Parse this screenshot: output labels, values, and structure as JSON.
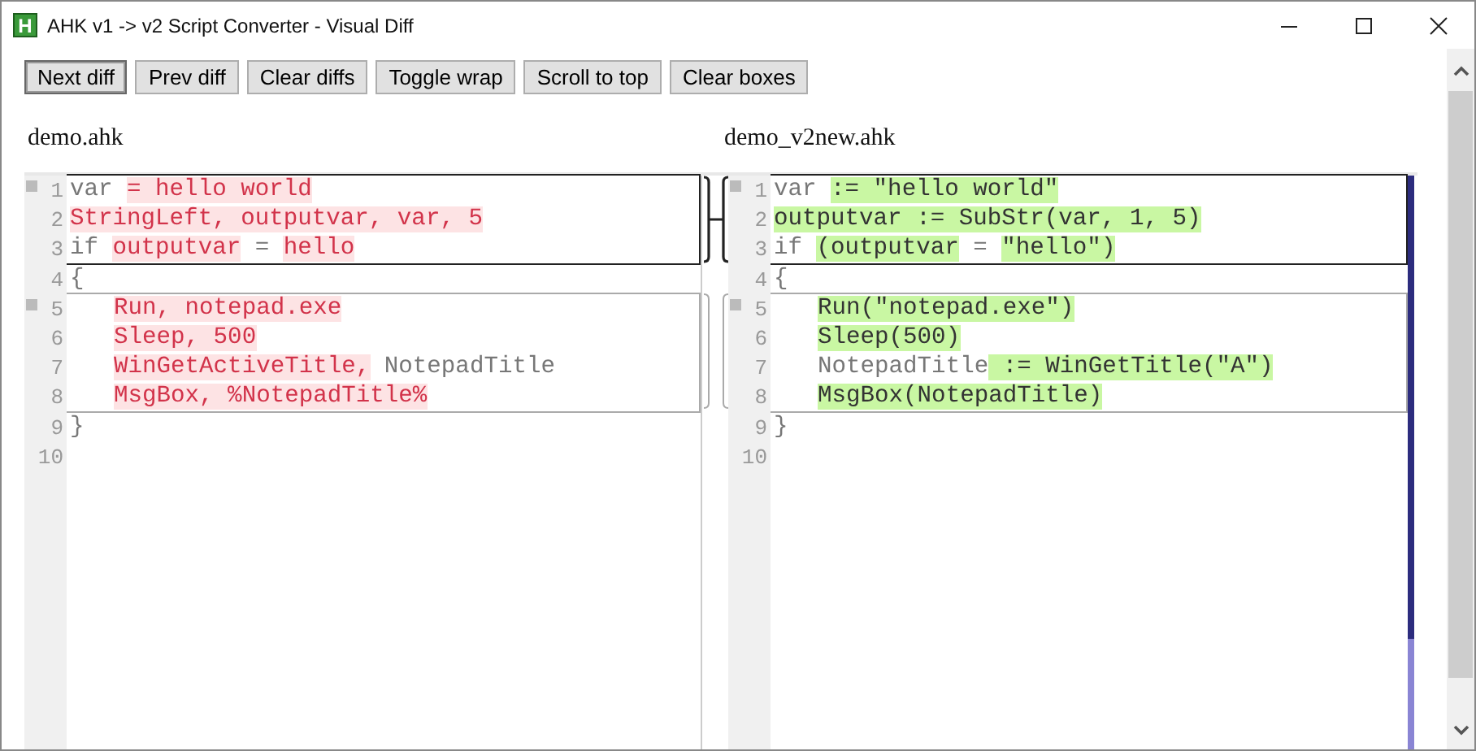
{
  "window": {
    "icon_letter": "H",
    "title": "AHK v1 -> v2 Script Converter - Visual Diff"
  },
  "toolbar": [
    {
      "label": "Next diff",
      "focused": true
    },
    {
      "label": "Prev diff",
      "focused": false
    },
    {
      "label": "Clear diffs",
      "focused": false
    },
    {
      "label": "Toggle wrap",
      "focused": false
    },
    {
      "label": "Scroll to top",
      "focused": false
    },
    {
      "label": "Clear boxes",
      "focused": false
    }
  ],
  "panes": [
    {
      "filename": "demo.ahk",
      "kind": "removed",
      "groups": [
        {
          "kind": "hunk",
          "active": true,
          "lines": [
            {
              "number": "1",
              "indented": false,
              "segments": [
                {
                  "text": "var ",
                  "changed": false
                },
                {
                  "text": "= hello world",
                  "changed": true
                }
              ]
            },
            {
              "number": "2",
              "indented": false,
              "segments": [
                {
                  "text": "StringLeft, outputvar, var, 5",
                  "changed": true
                }
              ]
            },
            {
              "number": "3",
              "indented": false,
              "segments": [
                {
                  "text": "if ",
                  "changed": false
                },
                {
                  "text": "outputvar",
                  "changed": true
                },
                {
                  "text": " = ",
                  "changed": false
                },
                {
                  "text": "hello",
                  "changed": true
                }
              ]
            }
          ]
        },
        {
          "kind": "plain",
          "lines": [
            {
              "number": "4",
              "indented": false,
              "segments": [
                {
                  "text": "{",
                  "changed": false
                }
              ]
            }
          ]
        },
        {
          "kind": "hunk",
          "active": false,
          "lines": [
            {
              "number": "5",
              "indented": true,
              "segments": [
                {
                  "text": "Run, notepad.exe",
                  "changed": true
                }
              ]
            },
            {
              "number": "6",
              "indented": true,
              "segments": [
                {
                  "text": "Sleep, 500",
                  "changed": true
                }
              ]
            },
            {
              "number": "7",
              "indented": true,
              "segments": [
                {
                  "text": "WinGetActiveTitle,",
                  "changed": true
                },
                {
                  "text": " NotepadTitle",
                  "changed": false
                }
              ]
            },
            {
              "number": "8",
              "indented": true,
              "segments": [
                {
                  "text": "MsgBox, %NotepadTitle%",
                  "changed": true
                }
              ]
            }
          ]
        },
        {
          "kind": "plain",
          "lines": [
            {
              "number": "9",
              "indented": false,
              "segments": [
                {
                  "text": "}",
                  "changed": false
                }
              ]
            },
            {
              "number": "10"
            }
          ]
        }
      ]
    },
    {
      "filename": "demo_v2new.ahk",
      "kind": "added",
      "groups": [
        {
          "kind": "hunk",
          "active": true,
          "lines": [
            {
              "number": "1",
              "indented": false,
              "segments": [
                {
                  "text": "var ",
                  "changed": false
                },
                {
                  "text": ":= \"hello world\"",
                  "changed": true
                }
              ]
            },
            {
              "number": "2",
              "indented": false,
              "segments": [
                {
                  "text": "outputvar := SubStr(var, 1, 5)",
                  "changed": true
                }
              ]
            },
            {
              "number": "3",
              "indented": false,
              "segments": [
                {
                  "text": "if ",
                  "changed": false
                },
                {
                  "text": "(outputvar",
                  "changed": true
                },
                {
                  "text": " = ",
                  "changed": false
                },
                {
                  "text": "\"hello\")",
                  "changed": true
                }
              ]
            }
          ]
        },
        {
          "kind": "plain",
          "lines": [
            {
              "number": "4",
              "indented": false,
              "segments": [
                {
                  "text": "{",
                  "changed": false
                }
              ]
            }
          ]
        },
        {
          "kind": "hunk",
          "active": false,
          "lines": [
            {
              "number": "5",
              "indented": true,
              "segments": [
                {
                  "text": "Run(\"notepad.exe\")",
                  "changed": true
                }
              ]
            },
            {
              "number": "6",
              "indented": true,
              "segments": [
                {
                  "text": "Sleep(500)",
                  "changed": true
                }
              ]
            },
            {
              "number": "7",
              "indented": true,
              "segments": [
                {
                  "text": "NotepadTitle",
                  "changed": false
                },
                {
                  "text": " := WinGetTitle(\"A\")",
                  "changed": true
                }
              ]
            },
            {
              "number": "8",
              "indented": true,
              "segments": [
                {
                  "text": "MsgBox(NotepadTitle)",
                  "changed": true
                }
              ]
            }
          ]
        },
        {
          "kind": "plain",
          "lines": [
            {
              "number": "9",
              "indented": false,
              "segments": [
                {
                  "text": "}",
                  "changed": false
                }
              ]
            },
            {
              "number": "10"
            }
          ]
        }
      ]
    }
  ]
}
